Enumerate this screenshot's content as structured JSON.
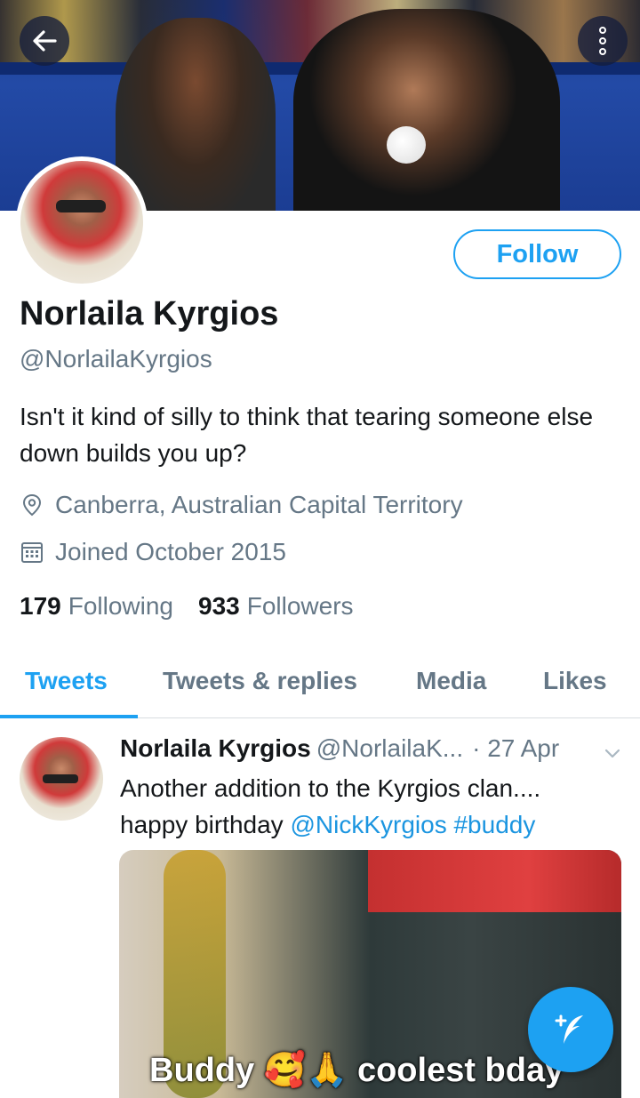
{
  "profile": {
    "name": "Norlaila Kyrgios",
    "handle": "@NorlailaKyrgios",
    "bio": "Isn't it kind of silly to think that tearing someone else down builds you up?",
    "location": "Canberra, Australian Capital Territory",
    "joined": "Joined October 2015",
    "following_count": "179",
    "following_label": "Following",
    "followers_count": "933",
    "followers_label": "Followers",
    "follow_label": "Follow"
  },
  "tabs": [
    {
      "label": "Tweets",
      "active": true
    },
    {
      "label": "Tweets & replies",
      "active": false
    },
    {
      "label": "Media",
      "active": false
    },
    {
      "label": "Likes",
      "active": false
    }
  ],
  "tweet": {
    "name": "Norlaila Kyrgios",
    "handle": "@NorlailaK...",
    "date": "· 27 Apr",
    "text_line1": "Another addition to the Kyrgios clan....",
    "text_prefix": "happy birthday ",
    "mention": "@NickKyrgios",
    "hashtag": "#buddy",
    "media_caption": "Buddy 🥰🙏 coolest bday"
  },
  "icons": {
    "back": "back-arrow-icon",
    "more": "more-options-icon",
    "location": "location-pin-icon",
    "calendar": "calendar-icon",
    "caret": "chevron-down-icon",
    "compose": "compose-tweet-icon"
  },
  "colors": {
    "accent": "#1da1f2",
    "secondary_text": "#657786",
    "primary_text": "#14171a"
  }
}
